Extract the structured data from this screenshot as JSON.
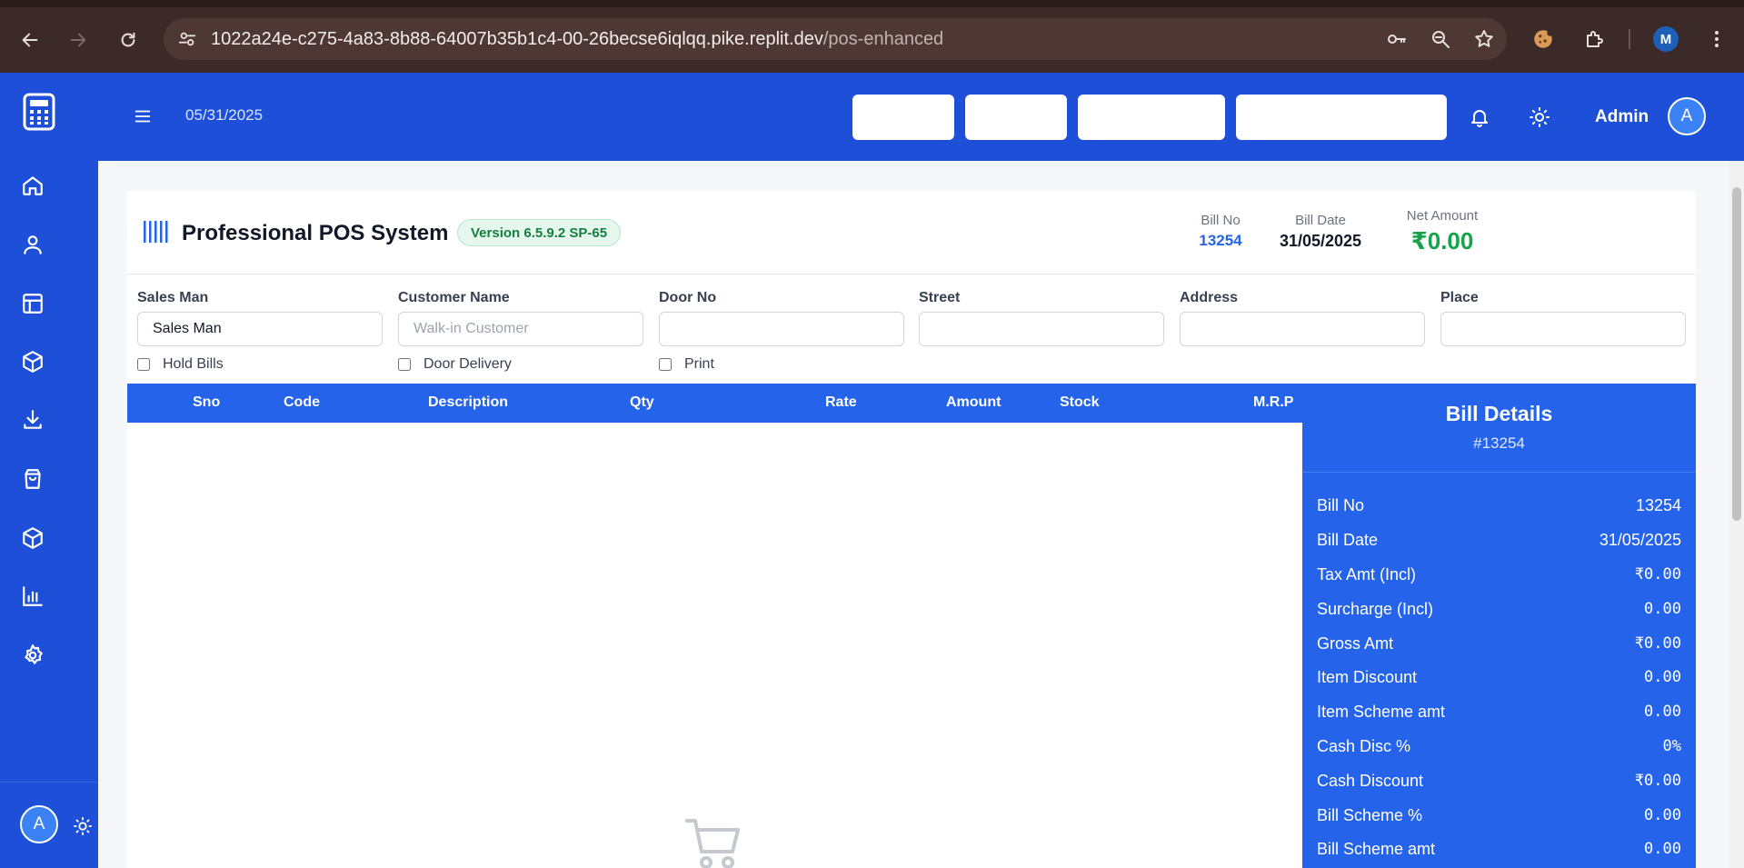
{
  "browser": {
    "url_host": "1022a24e-c275-4a83-8b88-64007b35b1c4-00-26becse6iqlqq.pike.replit.dev",
    "url_path": "/pos-enhanced",
    "profile_initial": "M"
  },
  "header": {
    "date": "05/31/2025",
    "user_name": "Admin",
    "avatar_initial": "A"
  },
  "sidebar": {
    "items": [
      "home-icon",
      "user-icon",
      "layout-icon",
      "package-icon",
      "download-icon",
      "shopping-bag-icon",
      "box-icon",
      "bar-chart-icon",
      "gear-icon"
    ],
    "avatar_initial": "A"
  },
  "pos": {
    "title": "Professional POS System",
    "version": "Version 6.5.9.2 SP-65",
    "bill_no_label": "Bill No",
    "bill_no": "13254",
    "bill_date_label": "Bill Date",
    "bill_date": "31/05/2025",
    "net_amount_label": "Net Amount",
    "net_amount": "₹0.00"
  },
  "form": {
    "sales_man": {
      "label": "Sales Man",
      "value": "Sales Man"
    },
    "customer_name": {
      "label": "Customer Name",
      "placeholder": "Walk-in Customer"
    },
    "door_no": {
      "label": "Door No"
    },
    "street": {
      "label": "Street"
    },
    "address": {
      "label": "Address"
    },
    "place": {
      "label": "Place"
    },
    "hold_bills": "Hold Bills",
    "door_delivery": "Door Delivery",
    "print": "Print"
  },
  "table": {
    "columns": [
      "Sno",
      "Code",
      "Description",
      "Qty",
      "Rate",
      "Amount",
      "Stock",
      "M.R.P"
    ]
  },
  "bill_details": {
    "title": "Bill Details",
    "subtitle": "#13254",
    "rows": [
      {
        "label": "Bill No",
        "value": "13254"
      },
      {
        "label": "Bill Date",
        "value": "31/05/2025"
      },
      {
        "label": "Tax Amt (Incl)",
        "value": "₹0.00"
      },
      {
        "label": "Surcharge (Incl)",
        "value": "0.00"
      },
      {
        "label": "Gross Amt",
        "value": "₹0.00"
      },
      {
        "label": "Item Discount",
        "value": "0.00"
      },
      {
        "label": "Item Scheme amt",
        "value": "0.00"
      },
      {
        "label": "Cash Disc %",
        "value": "0%"
      },
      {
        "label": "Cash Discount",
        "value": "₹0.00"
      },
      {
        "label": "Bill Scheme %",
        "value": "0.00"
      },
      {
        "label": "Bill Scheme amt",
        "value": "0.00"
      }
    ]
  },
  "colors": {
    "primary": "#1d4fd8",
    "table_header": "#2563eb",
    "bill_no_accent": "#2563eb",
    "net_amount": "#16a34a"
  }
}
